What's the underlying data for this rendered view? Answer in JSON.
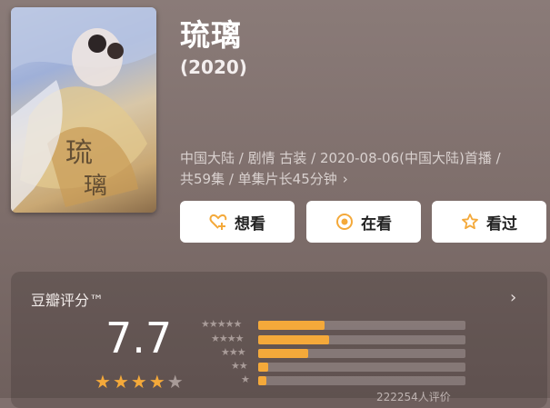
{
  "movie": {
    "title": "琉璃",
    "year": "(2020)",
    "meta_line1": "中国大陆 / 剧情 古装 / 2020-08-06(中国大陆)首播 /",
    "meta_line2": "共59集 / 单集片长45分钟",
    "meta_chevron": "›"
  },
  "actions": [
    {
      "label": "想看",
      "icon": "heart-plus-icon"
    },
    {
      "label": "在看",
      "icon": "circle-dot-icon"
    },
    {
      "label": "看过",
      "icon": "star-outline-icon"
    }
  ],
  "rating": {
    "label": "豆瓣评分™",
    "score": "7.7",
    "stars_filled": 4,
    "stars_total": 5,
    "chevron": "›",
    "distribution": [
      {
        "stars": 5,
        "fraction": 0.32
      },
      {
        "stars": 4,
        "fraction": 0.34
      },
      {
        "stars": 3,
        "fraction": 0.24
      },
      {
        "stars": 2,
        "fraction": 0.05
      },
      {
        "stars": 1,
        "fraction": 0.04
      }
    ],
    "count_note": "222254人评价"
  },
  "colors": {
    "accent": "#f4a93a",
    "background": "#80706e",
    "star_filled": "#f4a93a",
    "star_empty": "#a89b98"
  }
}
